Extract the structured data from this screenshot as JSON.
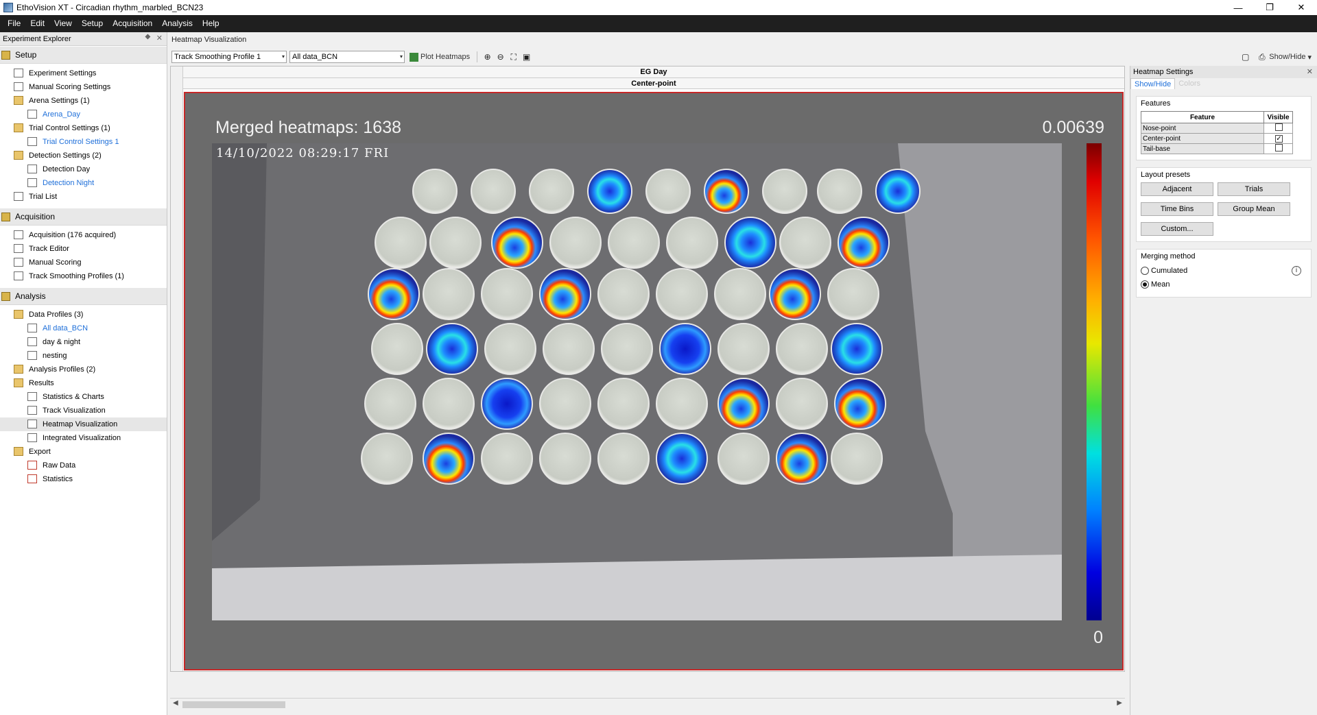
{
  "window": {
    "title": "EthoVision XT - Circadian rhythm_marbled_BCN23",
    "minimize": "—",
    "restore": "❐",
    "close": "✕"
  },
  "menu": [
    "File",
    "Edit",
    "View",
    "Setup",
    "Acquisition",
    "Analysis",
    "Help"
  ],
  "explorer": {
    "title": "Experiment Explorer",
    "pin": "⯁",
    "close": "✕",
    "sections": [
      {
        "label": "Setup",
        "items": [
          {
            "label": "Experiment Settings",
            "level": 1,
            "link": false,
            "icon": "settings-doc-icon"
          },
          {
            "label": "Manual Scoring Settings",
            "level": 1,
            "link": false,
            "icon": "settings-doc-icon"
          },
          {
            "label": "Arena Settings (1)",
            "level": 1,
            "link": false,
            "icon": "folder-icon"
          },
          {
            "label": "Arena_Day",
            "level": 2,
            "link": true,
            "icon": "arena-icon"
          },
          {
            "label": "Trial Control Settings (1)",
            "level": 1,
            "link": false,
            "icon": "folder-icon"
          },
          {
            "label": "Trial Control Settings 1",
            "level": 2,
            "link": true,
            "icon": "trial-control-icon"
          },
          {
            "label": "Detection Settings (2)",
            "level": 1,
            "link": false,
            "icon": "folder-icon"
          },
          {
            "label": "Detection Day",
            "level": 2,
            "link": false,
            "icon": "detection-icon"
          },
          {
            "label": "Detection Night",
            "level": 2,
            "link": true,
            "icon": "detection-icon"
          },
          {
            "label": "Trial List",
            "level": 1,
            "link": false,
            "icon": "list-icon"
          }
        ]
      },
      {
        "label": "Acquisition",
        "items": [
          {
            "label": "Acquisition (176 acquired)",
            "level": 1,
            "link": false,
            "icon": "acquisition-icon"
          },
          {
            "label": "Track Editor",
            "level": 1,
            "link": false,
            "icon": "track-editor-icon"
          },
          {
            "label": "Manual Scoring",
            "level": 1,
            "link": false,
            "icon": "manual-scoring-icon"
          },
          {
            "label": "Track Smoothing Profiles (1)",
            "level": 1,
            "link": false,
            "icon": "smoothing-icon"
          }
        ]
      },
      {
        "label": "Analysis",
        "items": [
          {
            "label": "Data Profiles (3)",
            "level": 1,
            "link": false,
            "icon": "folder-icon"
          },
          {
            "label": "All data_BCN",
            "level": 2,
            "link": true,
            "icon": "data-profile-icon"
          },
          {
            "label": "day & night",
            "level": 2,
            "link": false,
            "icon": "data-profile-icon"
          },
          {
            "label": "nesting",
            "level": 2,
            "link": false,
            "icon": "data-profile-icon"
          },
          {
            "label": "Analysis Profiles (2)",
            "level": 1,
            "link": false,
            "icon": "folder-icon"
          },
          {
            "label": "Results",
            "level": 1,
            "link": false,
            "icon": "folder-icon"
          },
          {
            "label": "Statistics & Charts",
            "level": 2,
            "link": false,
            "icon": "statistics-icon"
          },
          {
            "label": "Track Visualization",
            "level": 2,
            "link": false,
            "icon": "track-viz-icon"
          },
          {
            "label": "Heatmap Visualization",
            "level": 2,
            "link": false,
            "icon": "heatmap-icon",
            "selected": true
          },
          {
            "label": "Integrated Visualization",
            "level": 2,
            "link": false,
            "icon": "integrated-icon"
          },
          {
            "label": "Export",
            "level": 1,
            "link": false,
            "icon": "export-folder-icon"
          },
          {
            "label": "Raw Data",
            "level": 2,
            "link": false,
            "icon": "raw-data-icon"
          },
          {
            "label": "Statistics",
            "level": 2,
            "link": false,
            "icon": "statistics-export-icon"
          }
        ]
      }
    ]
  },
  "center": {
    "header": "Heatmap Visualization",
    "toolbar": {
      "smoothing_profile": "Track Smoothing Profile 1",
      "data_profile": "All data_BCN",
      "plot_button": "Plot Heatmaps",
      "show_hide": "Show/Hide",
      "dropdown_arrow": "▾",
      "zoom_in": "⊕",
      "zoom_out": "⊖",
      "zoom_fit": "⛶",
      "camera": "▣"
    },
    "row_header": "EG Day",
    "feature_header": "Center-point",
    "heatmap": {
      "title": "Merged heatmaps: 1638",
      "scale_max": "0.00639",
      "scale_min": "0",
      "timestamp": "14/10/2022 08:29:17 FRI"
    }
  },
  "settings": {
    "title": "Heatmap Settings",
    "close": "✕",
    "tabs": [
      "Show/Hide",
      "Colors"
    ],
    "features": {
      "title": "Features",
      "col_feature": "Feature",
      "col_visible": "Visible",
      "rows": [
        {
          "name": "Nose-point",
          "visible": false
        },
        {
          "name": "Center-point",
          "visible": true
        },
        {
          "name": "Tail-base",
          "visible": false
        }
      ]
    },
    "layout_presets": {
      "title": "Layout presets",
      "buttons": [
        "Adjacent",
        "Trials",
        "Time Bins",
        "Group Mean",
        "Custom..."
      ]
    },
    "merging": {
      "title": "Merging method",
      "options": [
        {
          "label": "Cumulated",
          "selected": false
        },
        {
          "label": "Mean",
          "selected": true
        }
      ],
      "info": "i"
    }
  }
}
